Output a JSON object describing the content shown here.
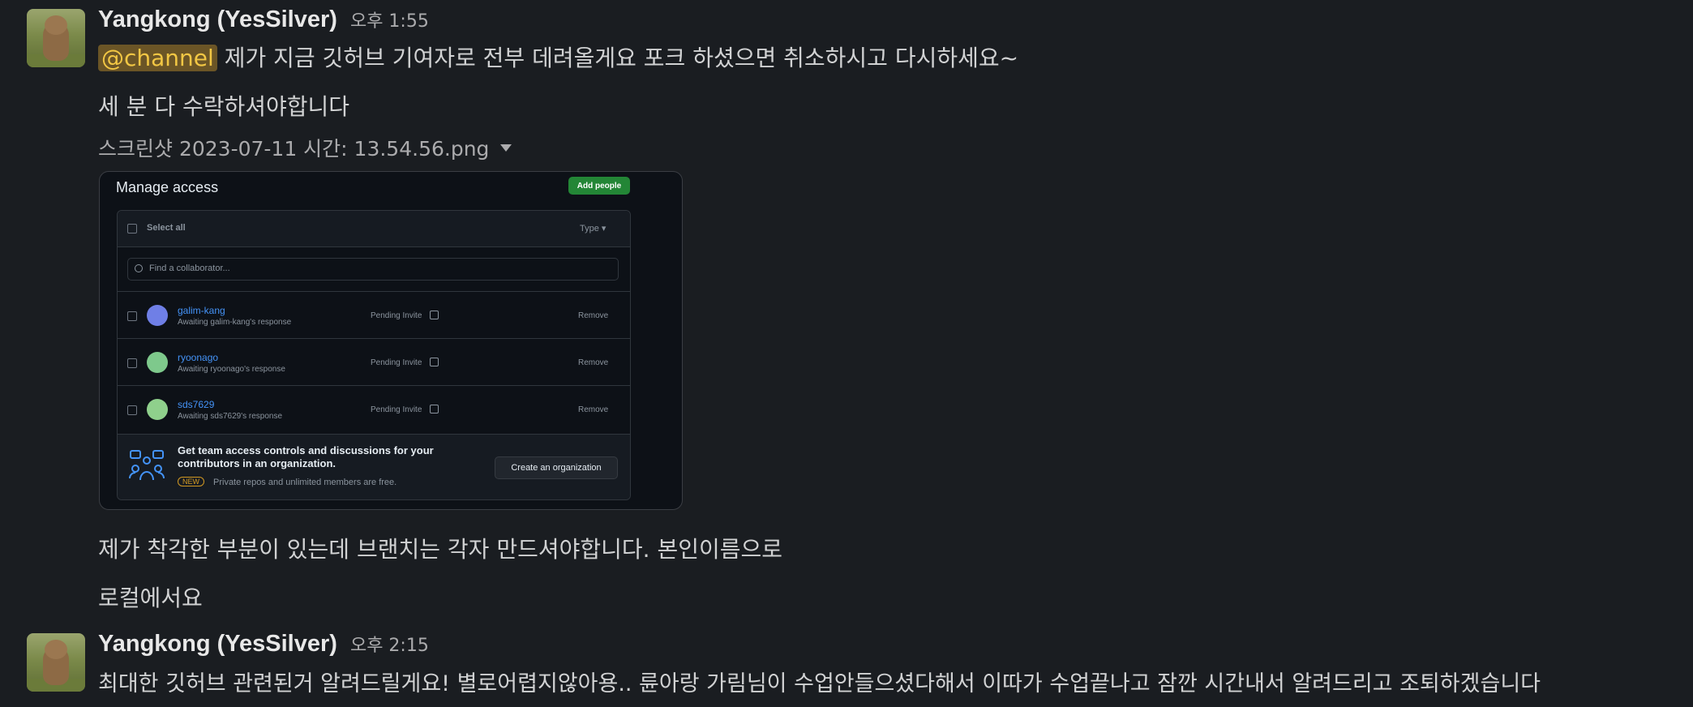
{
  "messages": [
    {
      "sender": "Yangkong (YesSilver)",
      "time": "오후 1:55",
      "mention": "@channel",
      "line1_rest": " 제가 지금 깃허브 기여자로 전부 데려올게요 포크 하셨으면 취소하시고 다시하세요~",
      "line2": "세 분 다 수락하셔야합니다",
      "attachment": {
        "filename": "스크린샷 2023-07-11 시간: 13.54.56.png",
        "screenshot": {
          "title": "Manage access",
          "add_people": "Add people",
          "select_all": "Select all",
          "type_filter": "Type ▾",
          "search_placeholder": "Find a collaborator...",
          "rows": [
            {
              "user": "galim-kang",
              "sub": "Awaiting galim-kang's response",
              "status": "Pending Invite",
              "action": "Remove",
              "avatar_color": "#6f7fe6"
            },
            {
              "user": "ryoonago",
              "sub": "Awaiting ryoonago's response",
              "status": "Pending Invite",
              "action": "Remove",
              "avatar_color": "#7ec98c"
            },
            {
              "user": "sds7629",
              "sub": "Awaiting sds7629's response",
              "status": "Pending Invite",
              "action": "Remove",
              "avatar_color": "#8fd08c"
            }
          ],
          "promo_text": "Get team access controls and discussions for your contributors in an organization.",
          "promo_badge": "NEW",
          "promo_sub": "Private repos and unlimited members are free.",
          "create_org": "Create an organization"
        }
      },
      "line3": "제가 착각한 부분이 있는데 브랜치는 각자 만드셔야합니다. 본인이름으로",
      "line4": "로컬에서요"
    },
    {
      "sender": "Yangkong (YesSilver)",
      "time": "오후 2:15",
      "line1": "최대한 깃허브 관련된거  알려드릴게요! 별로어렵지않아용.. 륜아랑 가림님이 수업안들으셨다해서 이따가 수업끝나고 잠깐 시간내서 알려드리고 조퇴하겠습니다"
    }
  ],
  "colors": {
    "background": "#1a1d21",
    "mention_bg": "#6b5526",
    "mention_text": "#f2c744",
    "link_blue": "#4493f8",
    "github_green": "#238636"
  }
}
